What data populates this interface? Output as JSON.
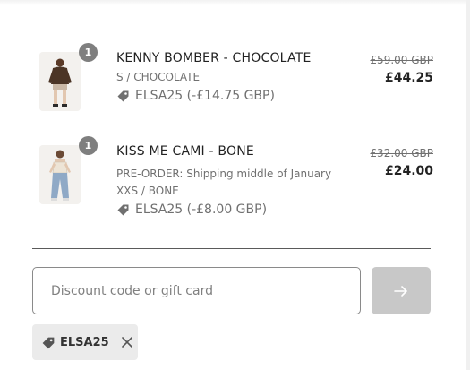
{
  "items": [
    {
      "quantity": "1",
      "title": "KENNY BOMBER - CHOCOLATE",
      "variant": "S / CHOCOLATE",
      "discount": "ELSA25 (-£14.75 GBP)",
      "price_original": "£59.00 GBP",
      "price_final": "£44.25",
      "thumb_icon": "product-photo-bomber"
    },
    {
      "quantity": "1",
      "title": "KISS ME CAMI - BONE",
      "preorder": "PRE-ORDER: Shipping middle of January",
      "variant": "XXS / BONE",
      "discount": "ELSA25 (-£8.00 GBP)",
      "price_original": "£32.00 GBP",
      "price_final": "£24.00",
      "thumb_icon": "product-photo-cami"
    }
  ],
  "discount_form": {
    "placeholder": "Discount code or gift card",
    "value": "",
    "apply_icon": "arrow-right-icon"
  },
  "applied_codes": [
    {
      "code": "ELSA25",
      "icon": "tag-icon",
      "remove_icon": "close-icon"
    }
  ],
  "colors": {
    "badge": "#7f7f7f",
    "apply_button": "#c8c8c8",
    "chip": "#ebebeb",
    "text_muted": "#707070"
  }
}
